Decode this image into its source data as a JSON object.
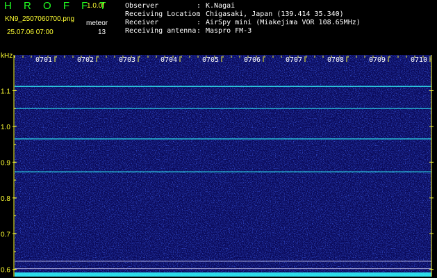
{
  "header": {
    "logo": "H R O F F T",
    "version": "1.0.0f",
    "filename": "KN9_2507060700.png",
    "datetime": "25.07.06 07:00",
    "meteor_label": "meteor",
    "meteor_count": "13",
    "info": [
      {
        "key": "Observer",
        "value": "K.Nagai"
      },
      {
        "key": "Receiving Location",
        "value": "Chigasaki, Japan (139.414 35.340)"
      },
      {
        "key": "Receiver",
        "value": "AirSpy mini (Miakejima VOR 108.65MHz)"
      },
      {
        "key": "Receiving antenna",
        "value": "Maspro FM-3"
      }
    ]
  },
  "colors": {
    "background": "#000000",
    "spectrogram": "#0a0a5a",
    "text_yellow": "#ffff33",
    "logo_green": "#22ff22",
    "signal_cyan": "#33ffff"
  },
  "chart_data": {
    "type": "heatmap",
    "ylabel": "kHz",
    "ylim": [
      0.58,
      1.2
    ],
    "yticks": [
      0.6,
      0.7,
      0.8,
      0.9,
      1.0,
      1.1
    ],
    "ytick_labels": [
      "0.6",
      "0.7",
      "0.8",
      "0.9",
      "1.0",
      "1.1"
    ],
    "x_categories": [
      "0701",
      "0702",
      "0703",
      "0704",
      "0705",
      "0706",
      "0707",
      "0708",
      "0709",
      "0710"
    ],
    "xlim": [
      0,
      10
    ],
    "carrier_lines_khz": [
      1.112,
      1.05,
      0.965,
      0.873
    ],
    "reference_lines_khz": [
      0.623,
      0.602
    ],
    "grid": false
  }
}
